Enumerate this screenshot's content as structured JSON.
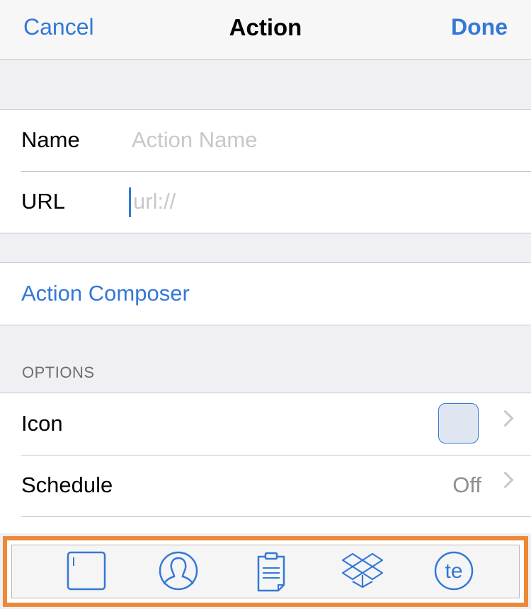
{
  "navbar": {
    "cancel_label": "Cancel",
    "title": "Action",
    "done_label": "Done"
  },
  "form": {
    "name": {
      "label": "Name",
      "placeholder": "Action Name",
      "value": ""
    },
    "url": {
      "label": "URL",
      "placeholder": "url://",
      "value": ""
    }
  },
  "composer": {
    "label": "Action Composer"
  },
  "options": {
    "header": "OPTIONS",
    "icon": {
      "label": "Icon"
    },
    "schedule": {
      "label": "Schedule",
      "value": "Off"
    }
  },
  "toolbar": {
    "buttons": [
      {
        "icon": "cursor-box-icon"
      },
      {
        "icon": "contact-icon"
      },
      {
        "icon": "clipboard-icon"
      },
      {
        "icon": "dropbox-icon"
      },
      {
        "icon": "textexpander-icon",
        "text": "te"
      }
    ]
  },
  "colors": {
    "accent": "#3478d6",
    "highlight": "#ed8936",
    "background": "#efeff4"
  }
}
